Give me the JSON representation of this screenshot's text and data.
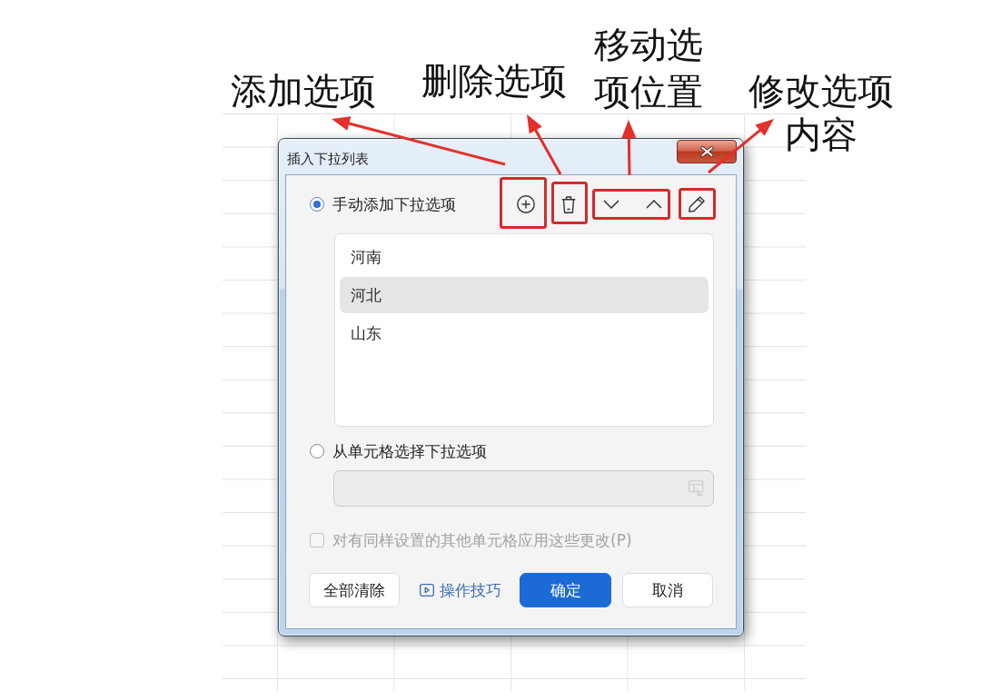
{
  "annotations": [
    {
      "label": "添加选项"
    },
    {
      "label": "删除选项"
    },
    {
      "label": "移动选项位置"
    },
    {
      "label": "修改选项内容"
    }
  ],
  "dialog": {
    "title": "插入下拉列表",
    "options": [
      {
        "label": "手动添加下拉选项",
        "selected": true
      },
      {
        "label": "从单元格选择下拉选项",
        "selected": false
      }
    ],
    "items": [
      {
        "text": "河南",
        "selected": false
      },
      {
        "text": "河北",
        "selected": true
      },
      {
        "text": "山东",
        "selected": false
      }
    ],
    "range_field": {
      "disabled": true
    },
    "apply_all": {
      "label": "对有同样设置的其他单元格应用这些更改(P)",
      "checked": false,
      "disabled": true
    },
    "buttons": [
      {
        "kind": "secondary",
        "label": "全部清除"
      },
      {
        "kind": "link",
        "label": "操作技巧"
      },
      {
        "kind": "primary",
        "label": "确定"
      },
      {
        "kind": "secondary",
        "label": "取消"
      }
    ]
  }
}
